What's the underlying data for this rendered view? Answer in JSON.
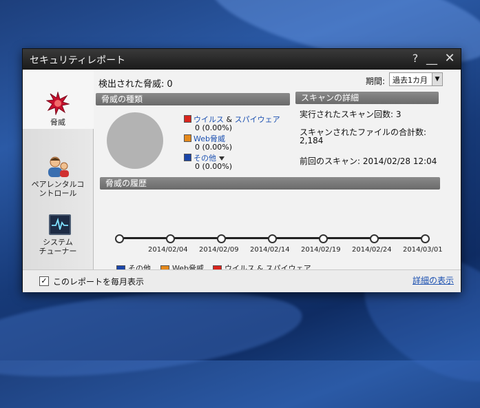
{
  "window": {
    "title": "セキュリティレポート",
    "help": "?",
    "minimize": "__",
    "close": "✕"
  },
  "sidebar": {
    "items": [
      {
        "label": "脅威"
      },
      {
        "label": "ペアレンタルコ\nントロール"
      },
      {
        "label": "システム\nチューナー"
      }
    ]
  },
  "header": {
    "detected_label": "検出された脅威:",
    "detected_count": "0",
    "period_label": "期間:",
    "period_value": "過去1カ月"
  },
  "threat_types": {
    "section_title": "脅威の種類",
    "items": [
      {
        "name": "ウイルス",
        "amp": "&",
        "name2": "スパイウェア",
        "count": "0 (0.00%)",
        "color": "#d9251d"
      },
      {
        "name": "Web脅威",
        "count": "0 (0.00%)",
        "color": "#e5891c"
      },
      {
        "name": "その他",
        "count": "0 (0.00%)",
        "color": "#1b46a8"
      }
    ]
  },
  "scan_details": {
    "section_title": "スキャンの詳細",
    "runs": "実行されたスキャン回数: 3",
    "files_label": "スキャンされたファイルの合計数:",
    "files_value": "2,184",
    "last_scan": "前回のスキャン: 2014/02/28 12:04"
  },
  "history": {
    "section_title": "脅威の履歴",
    "dates": [
      "2014/02/04",
      "2014/02/09",
      "2014/02/14",
      "2014/02/19",
      "2014/02/24",
      "2014/03/01"
    ],
    "legend": [
      {
        "label": "その他",
        "color": "#1b46a8"
      },
      {
        "label": "Web脅威",
        "color": "#e5891c"
      },
      {
        "label": "ウイルス & スパイウェア",
        "color": "#d9251d"
      }
    ]
  },
  "footer": {
    "checkbox_label": "このレポートを毎月表示",
    "checked": "✓",
    "detail_link": "詳細の表示"
  }
}
